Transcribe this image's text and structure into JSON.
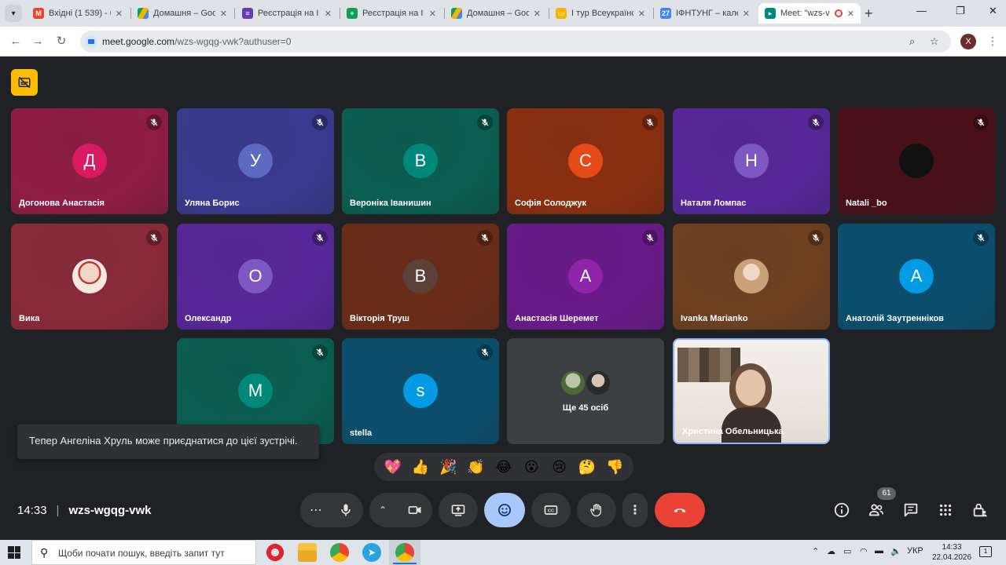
{
  "browser": {
    "tabs": [
      {
        "title": "Вхідні (1 539) - u",
        "favicon": "gmail-icon",
        "color": "#ea4335"
      },
      {
        "title": "Домашня – Goo",
        "favicon": "drive-icon",
        "color": "#1a73e8"
      },
      {
        "title": "Реєстрація на I т",
        "favicon": "forms-icon",
        "color": "#673ab7"
      },
      {
        "title": "Реєстрація на I т",
        "favicon": "sheets-icon",
        "color": "#0f9d58"
      },
      {
        "title": "Домашня – Goo",
        "favicon": "drive-icon",
        "color": "#1a73e8"
      },
      {
        "title": "I тур Всеукраїнс",
        "favicon": "slides-icon",
        "color": "#f4b400"
      },
      {
        "title": "ІФНТУНГ – кале",
        "favicon": "calendar-icon",
        "color": "#4285f4"
      },
      {
        "title": "Meet: \"wzs-v",
        "favicon": "meet-icon",
        "color": "#00897b",
        "active": true
      }
    ],
    "url_host": "meet.google.com",
    "url_path": "/wzs-wgqg-vwk?authuser=0",
    "profile_initial": "X"
  },
  "meet": {
    "participants": [
      {
        "name": "Догонова Анастасія",
        "initial": "Д",
        "bg": "#8f1d44",
        "avatar_color": "#d81b60",
        "muted": true
      },
      {
        "name": "Уляна Борис",
        "initial": "У",
        "bg": "#3a3b8f",
        "avatar_color": "#5c6bc0",
        "muted": true
      },
      {
        "name": "Вероніка Іванишин",
        "initial": "В",
        "bg": "#0b5e52",
        "avatar_color": "#00897b",
        "muted": true
      },
      {
        "name": "Софія Солоджук",
        "initial": "С",
        "bg": "#8a2f10",
        "avatar_color": "#e64a19",
        "muted": true
      },
      {
        "name": "Наталя Ломпас",
        "initial": "Н",
        "bg": "#58279a",
        "avatar_color": "#7e57c2",
        "muted": true
      },
      {
        "name": "Natali _bo",
        "initial": "",
        "bg": "#4a1018",
        "avatar_color": "#111111",
        "muted": true
      },
      {
        "name": "Вика",
        "initial": "",
        "bg": "#8a2a3a",
        "avatar_color": "#f5e8e0",
        "muted": true
      },
      {
        "name": "Олександр",
        "initial": "О",
        "bg": "#58279a",
        "avatar_color": "#7e57c2",
        "muted": true
      },
      {
        "name": "Вікторія Труш",
        "initial": "В",
        "bg": "#6b2d18",
        "avatar_color": "#5d4037",
        "muted": true
      },
      {
        "name": "Анастасія Шеремет",
        "initial": "А",
        "bg": "#6a1b8a",
        "avatar_color": "#8e24aa",
        "muted": true
      },
      {
        "name": "Ivanka Marianko",
        "initial": "",
        "bg": "#6e4020",
        "avatar_color": "#e0d0c0",
        "muted": true
      },
      {
        "name": "Анатолій Заутренніков",
        "initial": "А",
        "bg": "#0b4f6e",
        "avatar_color": "#039be5",
        "muted": true
      },
      {
        "name": "",
        "initial": "M",
        "bg": "#0b5e52",
        "avatar_color": "#00897b",
        "muted": true
      },
      {
        "name": "stella",
        "initial": "s",
        "bg": "#0b4f6e",
        "avatar_color": "#039be5",
        "muted": true
      }
    ],
    "more_label": "Ще 45 осіб",
    "presenter_name": "Христина Обельницька",
    "toast": "Тепер Ангеліна Хруль може приєднатися до цієї зустрічі.",
    "reactions": [
      "💖",
      "👍",
      "🎉",
      "👏",
      "😂",
      "😮",
      "😢",
      "🤔",
      "👎"
    ],
    "time": "14:33",
    "meeting_code": "wzs-wgqg-vwk",
    "people_count": "61"
  },
  "taskbar": {
    "search_placeholder": "Щоби почати пошук, введіть запит тут",
    "language": "УКР",
    "time": "14:33",
    "date": "22.04.2026",
    "notification_count": "1"
  }
}
